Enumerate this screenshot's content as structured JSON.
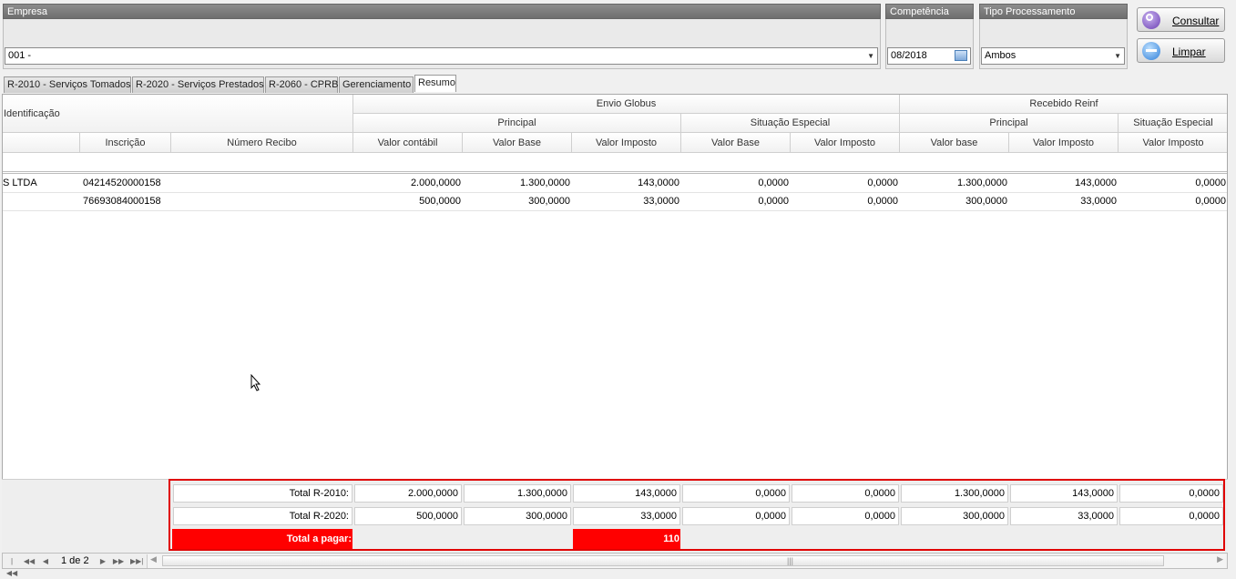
{
  "filters": {
    "empresa": {
      "label": "Empresa",
      "value": "001 -"
    },
    "competencia": {
      "label": "Competência",
      "value": "08/2018"
    },
    "tipo": {
      "label": "Tipo Processamento",
      "value": "Ambos"
    }
  },
  "buttons": {
    "consultar": "Consultar",
    "limpar": "Limpar"
  },
  "tabs": [
    {
      "label": "R-2010 - Serviços Tomados"
    },
    {
      "label": "R-2020 - Serviços Prestados"
    },
    {
      "label": "R-2060 - CPRB"
    },
    {
      "label": "Gerenciamento"
    },
    {
      "label": "Resumo"
    }
  ],
  "grid": {
    "identificacao": "Identificação",
    "envio_globus": "Envio Globus",
    "recebido_reinf": "Recebido Reinf",
    "principal": "Principal",
    "situacao_especial": "Situação Especial",
    "columns": [
      "Inscrição",
      "Número Recibo",
      "Valor contábil",
      "Valor Base",
      "Valor Imposto",
      "Valor Base",
      "Valor Imposto",
      "Valor base",
      "Valor Imposto",
      "Valor Imposto"
    ],
    "rows": [
      [
        "S LTDA",
        "04214520000158",
        "",
        "2.000,0000",
        "1.300,0000",
        "143,0000",
        "0,0000",
        "0,0000",
        "1.300,0000",
        "143,0000",
        "0,0000"
      ],
      [
        "",
        "76693084000158",
        "",
        "500,0000",
        "300,0000",
        "33,0000",
        "0,0000",
        "0,0000",
        "300,0000",
        "33,0000",
        "0,0000"
      ]
    ]
  },
  "totals": {
    "r2010": {
      "label": "Total R-2010:",
      "values": [
        "2.000,0000",
        "1.300,0000",
        "143,0000",
        "0,0000",
        "0,0000",
        "1.300,0000",
        "143,0000",
        "0,0000"
      ]
    },
    "r2020": {
      "label": "Total R-2020:",
      "values": [
        "500,0000",
        "300,0000",
        "33,0000",
        "0,0000",
        "0,0000",
        "300,0000",
        "33,0000",
        "0,0000"
      ]
    },
    "pagar": {
      "label": "Total a pagar:",
      "value": "110"
    }
  },
  "navigator": {
    "page": "1 de 2"
  },
  "colors": {
    "highlight": "#ff0000",
    "header": "#7a7a7a"
  }
}
